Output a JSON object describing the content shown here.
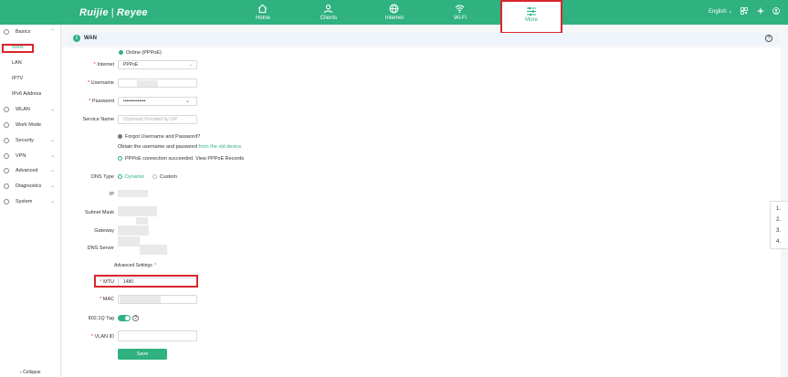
{
  "brand": {
    "name_left": "Ruijie",
    "separator": "|",
    "name_right": "Reyee"
  },
  "nav": {
    "items": [
      {
        "label": "Home",
        "icon": "home-icon"
      },
      {
        "label": "Clients",
        "icon": "users-icon"
      },
      {
        "label": "Internet",
        "icon": "globe-icon"
      },
      {
        "label": "Wi-Fi",
        "icon": "wifi-icon"
      },
      {
        "label": "More",
        "icon": "sliders-icon",
        "active": true
      }
    ]
  },
  "topright": {
    "language": "English",
    "lang_chevron": "⌄",
    "qr_icon": "qr-icon",
    "network_icon": "network-icon",
    "user_icon": "user-icon"
  },
  "sidebar": {
    "groups": [
      {
        "label": "Basics",
        "icon": "basics-icon",
        "expanded": true
      },
      {
        "label": "WLAN",
        "icon": "wlan-icon"
      },
      {
        "label": "Work Mode",
        "icon": "workmode-icon"
      },
      {
        "label": "Security",
        "icon": "security-icon"
      },
      {
        "label": "VPN",
        "icon": "vpn-icon"
      },
      {
        "label": "Advanced",
        "icon": "advanced-icon"
      },
      {
        "label": "Diagnostics",
        "icon": "diagnostics-icon"
      },
      {
        "label": "System",
        "icon": "system-icon"
      }
    ],
    "basics_items": [
      "WAN",
      "LAN",
      "IPTV",
      "IPv6 Address"
    ],
    "collapse_label": "Collapse"
  },
  "panel": {
    "title": "WAN",
    "info_glyph": "i",
    "help_glyph": "?"
  },
  "form": {
    "status": "Online (PPPoE)",
    "internet": {
      "label": "Internet",
      "value": "PPPoE"
    },
    "username": {
      "label": "Username"
    },
    "password": {
      "label": "Password",
      "value": "••••••••••••••"
    },
    "service_name": {
      "label": "Service Name",
      "placeholder": "(Optional) Provided by ISP"
    },
    "forgot": "Forgot Username and Password?",
    "obtain_text": "Obtain the username and password",
    "obtain_link": "from the old device.",
    "pppoe_success": "PPPoE connection succeeded.",
    "view_records": "View PPPoE Records",
    "dns_type": {
      "label": "DNS Type",
      "dynamic": "Dynamic",
      "custom": "Custom"
    },
    "ip": {
      "label": "IP"
    },
    "subnet": {
      "label": "Subnet Mask"
    },
    "gateway": {
      "label": "Gateway"
    },
    "dns_server": {
      "label": "DNS Server"
    },
    "advanced_settings": "Advanced Settings",
    "mtu": {
      "label": "MTU",
      "value": "1480"
    },
    "mac": {
      "label": "MAC"
    },
    "vlan_tag": {
      "label": "802.1Q Tag",
      "enabled": true
    },
    "vlan_id": {
      "label": "VLAN ID"
    },
    "save": "Save"
  },
  "right_popover": {
    "items": [
      "1.",
      "2.",
      "3.",
      "4."
    ]
  },
  "colors": {
    "accent": "#2fb180",
    "highlight": "#d9262c"
  }
}
